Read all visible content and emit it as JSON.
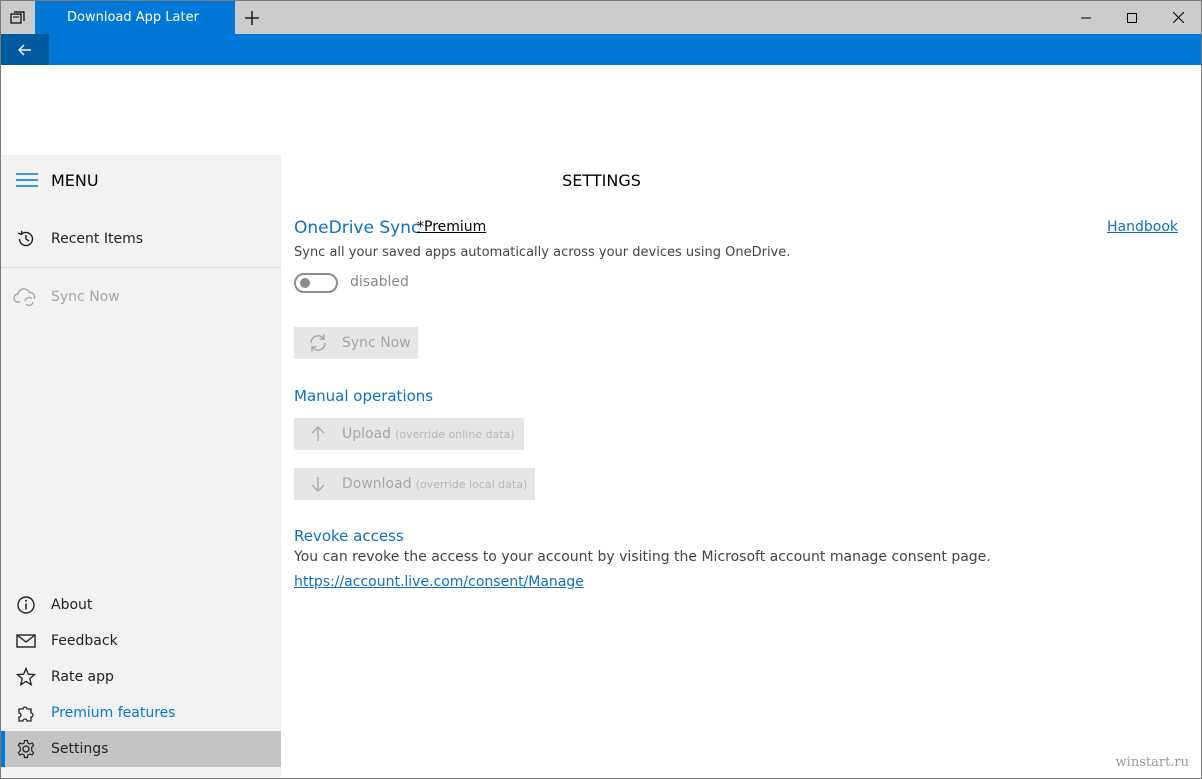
{
  "window": {
    "tab_title": "Download App Later"
  },
  "sidebar": {
    "menu_label": "MENU",
    "top_items": [
      {
        "label": "Recent Items"
      },
      {
        "label": "Sync Now"
      }
    ],
    "bottom_items": [
      {
        "label": "About"
      },
      {
        "label": "Feedback"
      },
      {
        "label": "Rate app"
      },
      {
        "label": "Premium features"
      },
      {
        "label": "Settings"
      }
    ]
  },
  "main": {
    "page_title": "SETTINGS",
    "onedrive": {
      "title": "OneDrive Sync",
      "premium_label": "*Premium",
      "handbook_label": "Handbook",
      "description": "Sync all your saved apps automatically across your devices using OneDrive.",
      "toggle_state": "disabled",
      "sync_button": "Sync Now"
    },
    "manual": {
      "title": "Manual operations",
      "upload_label": "Upload",
      "upload_hint": "(override online data)",
      "download_label": "Download",
      "download_hint": "(override local data)"
    },
    "revoke": {
      "title": "Revoke access",
      "description": "You can revoke the access to your account by visiting the Microsoft account manage consent page.",
      "link": "https://account.live.com/consent/Manage"
    }
  },
  "watermark": "winstart.ru",
  "colors": {
    "accent": "#0078d7",
    "titlebar": "#cccccc",
    "sidebar": "#f2f2f2",
    "selected": "#c4c4c4"
  }
}
